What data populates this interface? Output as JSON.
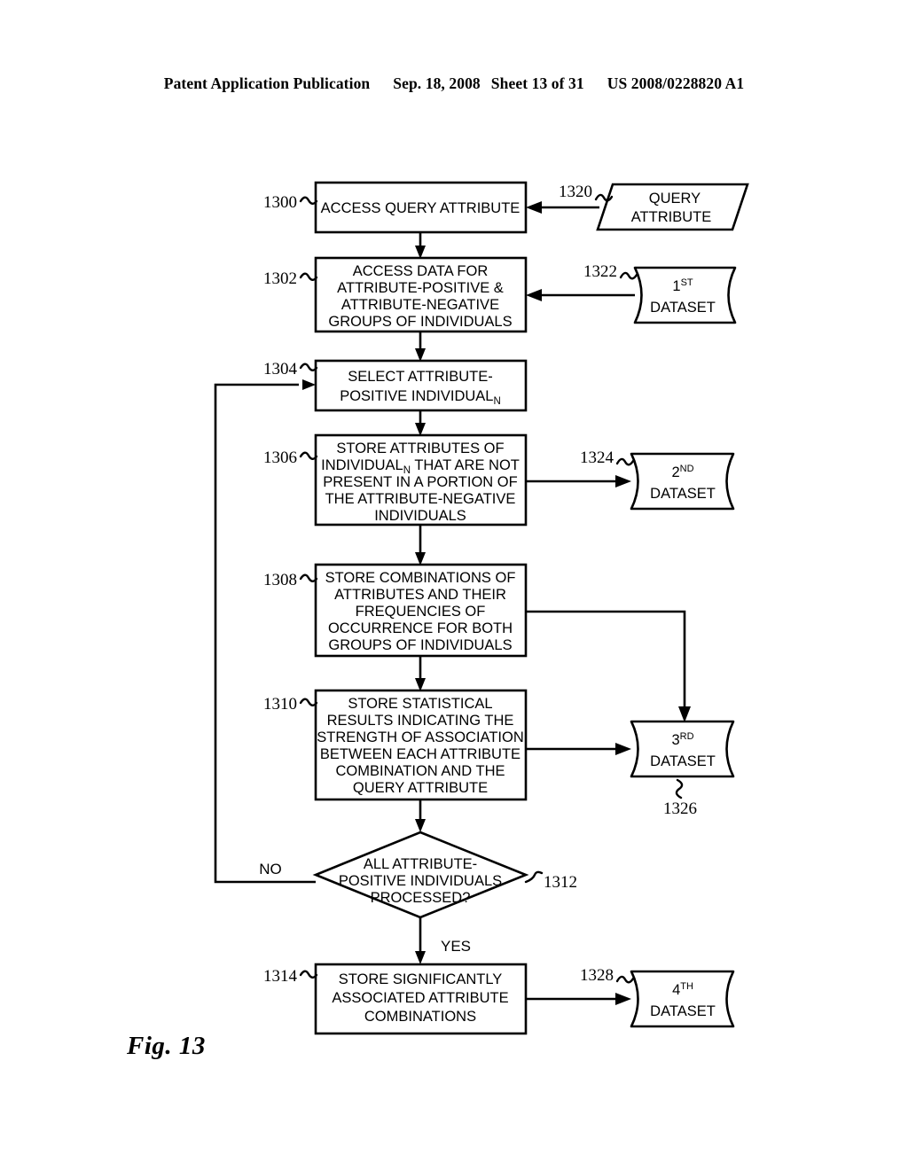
{
  "header": {
    "publication": "Patent Application Publication",
    "date": "Sep. 18, 2008",
    "sheet": "Sheet 13 of 31",
    "patent_number": "US 2008/0228820 A1"
  },
  "figure": {
    "caption": "Fig. 13"
  },
  "flowchart": {
    "steps": [
      {
        "ref": "1300",
        "shape": "process",
        "lines": [
          "ACCESS QUERY ATTRIBUTE"
        ]
      },
      {
        "ref": "1302",
        "shape": "process",
        "lines": [
          "ACCESS DATA FOR",
          "ATTRIBUTE-POSITIVE &",
          "ATTRIBUTE-NEGATIVE",
          "GROUPS OF INDIVIDUALS"
        ]
      },
      {
        "ref": "1304",
        "shape": "process",
        "lines": [
          "SELECT ATTRIBUTE-",
          "POSITIVE INDIVIDUAL"
        ],
        "subscript_last": "N"
      },
      {
        "ref": "1306",
        "shape": "process",
        "lines": [
          "STORE ATTRIBUTES OF",
          "INDIVIDUAL|N| THAT ARE NOT",
          "PRESENT IN A PORTION OF",
          "THE ATTRIBUTE-NEGATIVE",
          "INDIVIDUALS"
        ]
      },
      {
        "ref": "1308",
        "shape": "process",
        "lines": [
          "STORE COMBINATIONS OF",
          "ATTRIBUTES AND THEIR",
          "FREQUENCIES OF",
          "OCCURRENCE FOR BOTH",
          "GROUPS OF INDIVIDUALS"
        ]
      },
      {
        "ref": "1310",
        "shape": "process",
        "lines": [
          "STORE STATISTICAL",
          "RESULTS INDICATING THE",
          "STRENGTH OF ASSOCIATION",
          "BETWEEN EACH ATTRIBUTE",
          "COMBINATION AND THE",
          "QUERY ATTRIBUTE"
        ]
      },
      {
        "ref": "1312",
        "shape": "decision",
        "lines": [
          "ALL ATTRIBUTE-",
          "POSITIVE INDIVIDUALS",
          "PROCESSED?"
        ]
      },
      {
        "ref": "1314",
        "shape": "process",
        "lines": [
          "STORE SIGNIFICANTLY",
          "ASSOCIATED ATTRIBUTE",
          "COMBINATIONS"
        ]
      }
    ],
    "data_objects": [
      {
        "ref": "1320",
        "shape": "input-parallelogram",
        "lines": [
          "QUERY",
          "ATTRIBUTE"
        ]
      },
      {
        "ref": "1322",
        "shape": "dataset",
        "ordinal": "1",
        "ordinal_suffix": "ST",
        "label": "DATASET"
      },
      {
        "ref": "1324",
        "shape": "dataset",
        "ordinal": "2",
        "ordinal_suffix": "ND",
        "label": "DATASET"
      },
      {
        "ref": "1326",
        "shape": "dataset",
        "ordinal": "3",
        "ordinal_suffix": "RD",
        "label": "DATASET"
      },
      {
        "ref": "1328",
        "shape": "dataset",
        "ordinal": "4",
        "ordinal_suffix": "TH",
        "label": "DATASET"
      }
    ],
    "branch_labels": {
      "no": "NO",
      "yes": "YES"
    }
  },
  "colors": {
    "ink": "#000000",
    "paper": "#ffffff"
  }
}
